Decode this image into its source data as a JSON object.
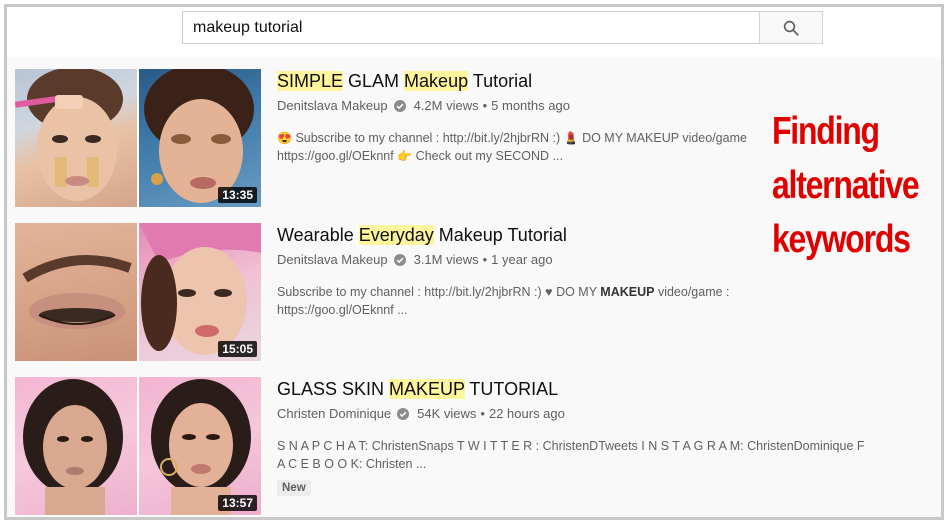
{
  "search": {
    "query": "makeup tutorial"
  },
  "results": [
    {
      "title_parts": [
        {
          "text": "SIMPLE",
          "hl": true
        },
        {
          "text": " GLAM ",
          "hl": false
        },
        {
          "text": "Makeup",
          "hl": true
        },
        {
          "text": " Tutorial",
          "hl": false
        }
      ],
      "channel": "Denitslava Makeup",
      "views": "4.2M views",
      "age": "5 months ago",
      "description_line1": "Subscribe to my channel : http://bit.ly/2hjbrRN :)",
      "description_line1b": "DO MY MAKEUP video/game",
      "description_line2": "https://goo.gl/OEknnf",
      "description_line2b": "Check out my SECOND ...",
      "duration": "13:35"
    },
    {
      "title_parts": [
        {
          "text": "Wearable ",
          "hl": false
        },
        {
          "text": "Everyday",
          "hl": true
        },
        {
          "text": " Makeup Tutorial",
          "hl": false
        }
      ],
      "channel": "Denitslava Makeup",
      "views": "3.1M views",
      "age": "1 year ago",
      "description_line1": "Subscribe to my channel : http://bit.ly/2hjbrRN :) ♥ DO MY",
      "description_bold": "MAKEUP",
      "description_line1b": "video/game :",
      "description_line2": "https://goo.gl/OEknnf ...",
      "duration": "15:05"
    },
    {
      "title_parts": [
        {
          "text": "GLASS SKIN ",
          "hl": false
        },
        {
          "text": "MAKEUP",
          "hl": true
        },
        {
          "text": " TUTORIAL",
          "hl": false
        }
      ],
      "channel": "Christen Dominique",
      "views": "54K views",
      "age": "22 hours ago",
      "description_line1": "S N A P C H A T: ChristenSnaps T W I T T E R : ChristenDTweets I N S T A G R A M: ChristenDominique F",
      "description_line2": "A C E B O O K: Christen ...",
      "badge": "New",
      "duration": "13:57"
    }
  ],
  "annotation": {
    "line1": "Finding",
    "line2": "alternative",
    "line3": "keywords",
    "color": "#e00000"
  },
  "icons": {
    "search": "search-icon",
    "verified": "verified-check-icon"
  },
  "colors": {
    "highlight": "#fff59d",
    "meta_text": "#606060"
  }
}
